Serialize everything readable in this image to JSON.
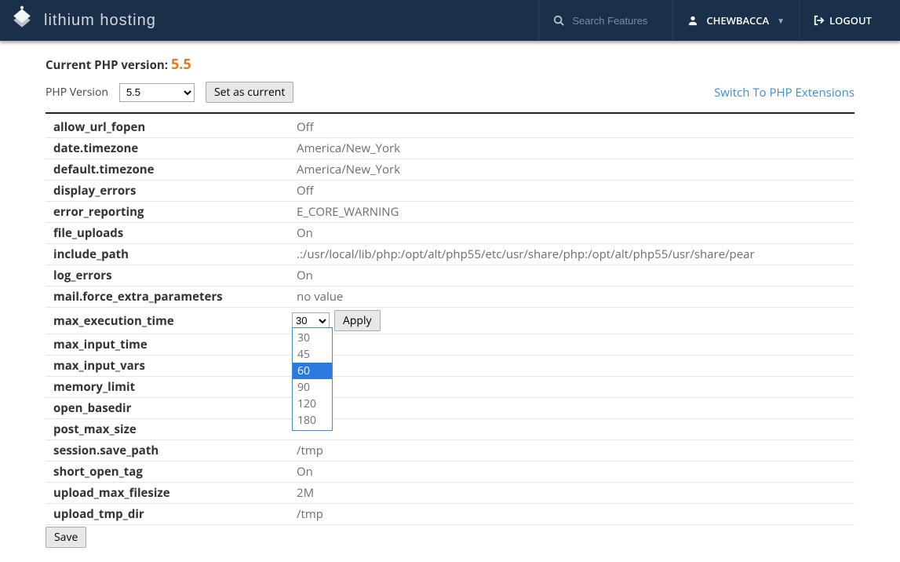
{
  "header": {
    "brand": "lithium hosting",
    "search_placeholder": "Search Features",
    "username": "CHEWBACCA",
    "logout": "LOGOUT"
  },
  "current_version_label": "Current PHP version:",
  "current_version_value": "5.5",
  "php_version_label": "PHP Version",
  "php_version_selected": "5.5",
  "set_current_btn": "Set as current",
  "switch_link": "Switch To PHP Extensions",
  "settings": [
    {
      "name": "allow_url_fopen",
      "value": "Off"
    },
    {
      "name": "date.timezone",
      "value": "America/New_York",
      "is_link": true
    },
    {
      "name": "default.timezone",
      "value": "America/New_York"
    },
    {
      "name": "display_errors",
      "value": "Off"
    },
    {
      "name": "error_reporting",
      "value": "E_CORE_WARNING"
    },
    {
      "name": "file_uploads",
      "value": "On"
    },
    {
      "name": "include_path",
      "value": ".:/usr/local/lib/php:/opt/alt/php55/etc/usr/share/php:/opt/alt/php55/usr/share/pear"
    },
    {
      "name": "log_errors",
      "value": "On"
    },
    {
      "name": "mail.force_extra_parameters",
      "value": "no value"
    },
    {
      "name": "max_execution_time",
      "value": "30",
      "editor": true,
      "options": [
        "30",
        "45",
        "60",
        "90",
        "120",
        "180"
      ],
      "highlighted": "60"
    },
    {
      "name": "max_input_time",
      "value": ""
    },
    {
      "name": "max_input_vars",
      "value": ""
    },
    {
      "name": "memory_limit",
      "value": ""
    },
    {
      "name": "open_basedir",
      "value": ""
    },
    {
      "name": "post_max_size",
      "value": ""
    },
    {
      "name": "session.save_path",
      "value": "/tmp"
    },
    {
      "name": "short_open_tag",
      "value": "On"
    },
    {
      "name": "upload_max_filesize",
      "value": "2M"
    },
    {
      "name": "upload_tmp_dir",
      "value": "/tmp"
    }
  ],
  "apply_btn": "Apply",
  "save_btn": "Save"
}
